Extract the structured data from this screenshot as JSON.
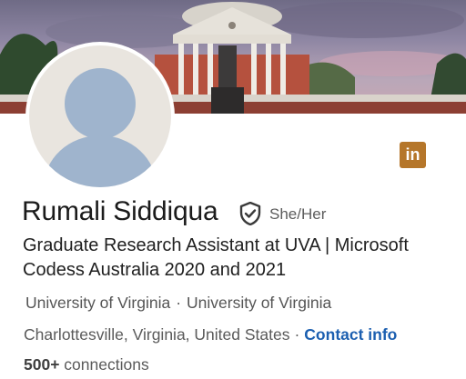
{
  "profile": {
    "name": "Rumali Siddiqua",
    "pronouns": "She/Her",
    "headline": "Graduate Research Assistant at UVA | Microsoft Codess Australia 2020 and 2021",
    "education": [
      "University of Virginia",
      "University of Virginia"
    ],
    "education_separator": "·",
    "location": "Charlottesville, Virginia, United States",
    "location_separator": "·",
    "contact_link": "Contact info",
    "connections_count": "500+",
    "connections_label": "connections"
  },
  "badge": {
    "text": "in",
    "icon": "linkedin-logo-icon"
  },
  "icons": {
    "verified": "shield-check-icon",
    "avatar": "default-avatar-icon"
  },
  "colors": {
    "link": "#1c5fb0",
    "badge": "#b5762a",
    "avatar_bg": "#e9e5df",
    "avatar_figure": "#9fb4cd"
  }
}
